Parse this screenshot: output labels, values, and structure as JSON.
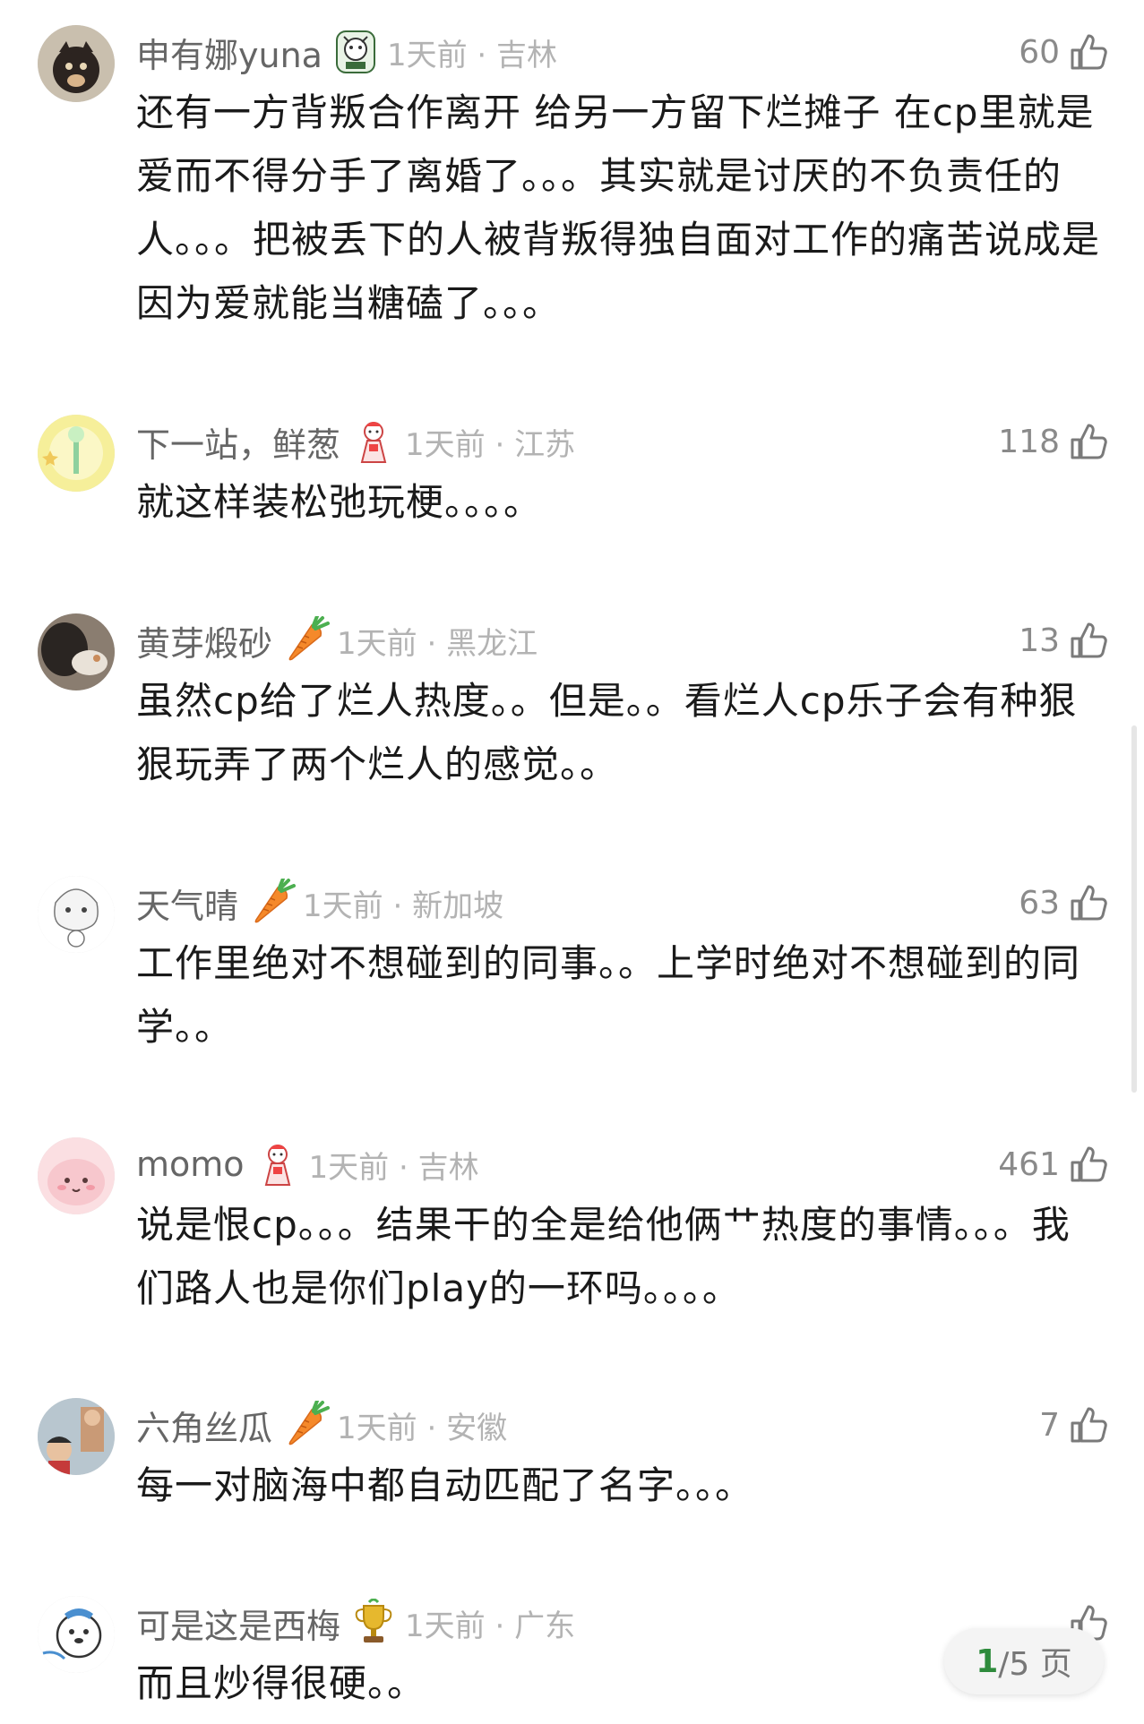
{
  "comments": [
    {
      "username": "申有娜yuna",
      "badge_icon": "cat-badge-icon",
      "time_location": "1天前 · 吉林",
      "likes": "60",
      "text": "还有一方背叛合作离开 给另一方留下烂摊子 在cp里就是爱而不得分手了离婚了。。。其实就是讨厌的不负责任的人。。。把被丢下的人被背叛得独自面对工作的痛苦说成是因为爱就能当糖磕了。。。"
    },
    {
      "username": "下一站，鲜葱",
      "badge_icon": "doll-badge-icon",
      "time_location": "1天前 · 江苏",
      "likes": "118",
      "text": "就这样装松弛玩梗。。。。"
    },
    {
      "username": "黄芽煅砂",
      "badge_icon": "carrot-badge-icon",
      "time_location": "1天前 · 黑龙江",
      "likes": "13",
      "text": "虽然cp给了烂人热度。。但是。。看烂人cp乐子会有种狠狠玩弄了两个烂人的感觉。。"
    },
    {
      "username": "天气晴",
      "badge_icon": "carrot-badge-icon",
      "time_location": "1天前 · 新加坡",
      "likes": "63",
      "text": "工作里绝对不想碰到的同事。。上学时绝对不想碰到的同学。。"
    },
    {
      "username": "momo",
      "badge_icon": "doll-badge-icon",
      "time_location": "1天前 · 吉林",
      "likes": "461",
      "text": "说是恨cp。。。结果干的全是给他俩艹热度的事情。。。我们路人也是你们play的一环吗。。。。"
    },
    {
      "username": "六角丝瓜",
      "badge_icon": "carrot-badge-icon",
      "time_location": "1天前 · 安徽",
      "likes": "7",
      "text": "每一对脑海中都自动匹配了名字。。。"
    },
    {
      "username": "可是这是西梅",
      "badge_icon": "trophy-badge-icon",
      "time_location": "1天前 · 广东",
      "likes": "",
      "text": "而且炒得很硬。。"
    }
  ],
  "pager": {
    "current": "1",
    "total_label": "/5 页"
  }
}
